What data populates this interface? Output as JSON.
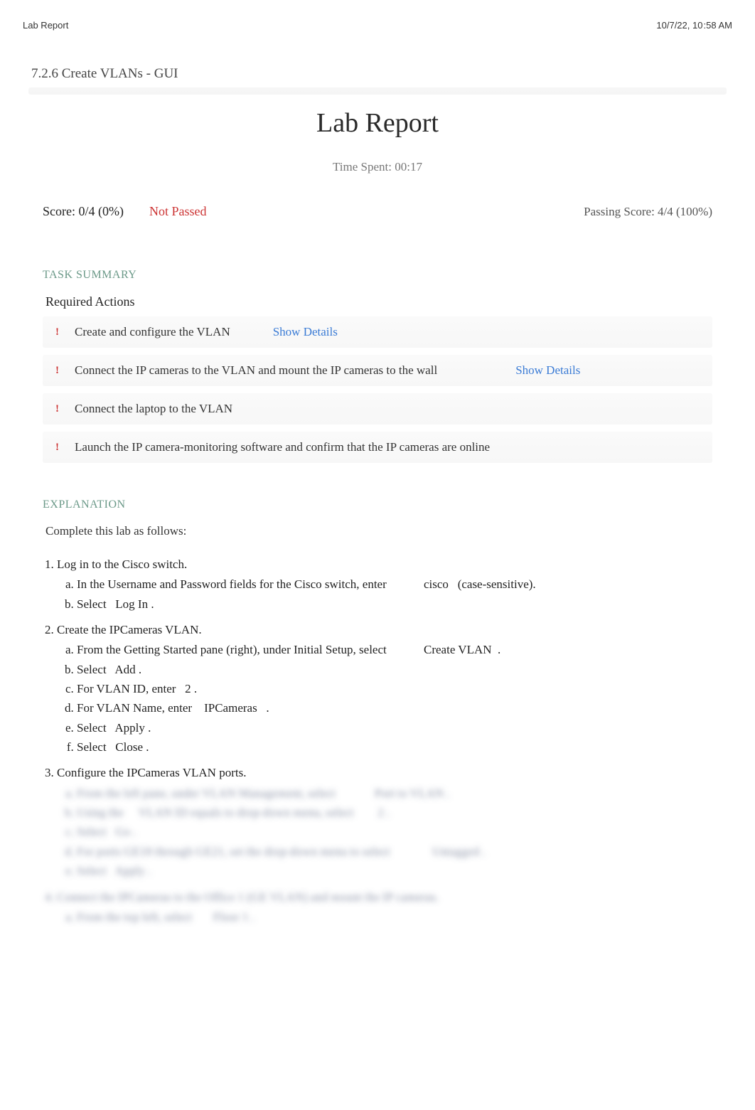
{
  "header": {
    "left": "Lab Report",
    "right": "10/7/22, 10 :58 AM"
  },
  "exercise_title": "7.2.6 Create VLANs - GUI",
  "main_title": "Lab Report",
  "time_spent": "Time Spent: 00:17",
  "score": {
    "text": "Score: 0/4 (0%)",
    "status": "Not Passed",
    "passing": "Passing Score: 4/4 (100%)"
  },
  "task_summary_heading": "TASK SUMMARY",
  "required_actions_label": "Required Actions",
  "actions": [
    {
      "text": "Create and configure the VLAN",
      "details": "Show Details"
    },
    {
      "text": "Connect the IP cameras to the VLAN and mount the IP cameras to the wall",
      "details": "Show Details"
    },
    {
      "text": "Connect the laptop to the VLAN",
      "details": null
    },
    {
      "text": "Launch the IP camera-monitoring software and confirm that the IP cameras are online",
      "details": null
    }
  ],
  "explanation_heading": "EXPLANATION",
  "explanation_intro": "Complete this lab as follows:",
  "steps": {
    "s1": {
      "title": "Log in to the Cisco switch.",
      "a_pre": "In the Username and Password fields for the Cisco switch, enter",
      "a_val": "cisco",
      "a_post": "  (case-sensitive).",
      "b": "Select   Log In ."
    },
    "s2": {
      "title": "Create the IPCameras VLAN.",
      "a_pre": "From the Getting Started pane (right), under Initial Setup, select",
      "a_val": "Create VLAN  .",
      "b": "Select   Add .",
      "c": "For VLAN ID, enter   2 .",
      "d_pre": "For VLAN Name, enter    ",
      "d_val": "IPCameras   .",
      "e": "Select   Apply .",
      "f": "Select   Close ."
    },
    "s3": {
      "title": "Configure the IPCameras VLAN ports.",
      "a": "From the left pane, under VLAN Management, select             Port to VLAN .",
      "b": "Using the     VLAN ID equals to drop-down menu, select        2 .",
      "c": "Select   Go .",
      "d": "For ports GE18 through GE21, set the drop-down menu to select              Untagged .",
      "e": "Select   Apply ."
    },
    "s4": {
      "title": "Connect the IPCameras to the Office 1 (GE VLAN) and mount the IP cameras.",
      "a": "From the top left, select       Floor 1 ."
    }
  }
}
